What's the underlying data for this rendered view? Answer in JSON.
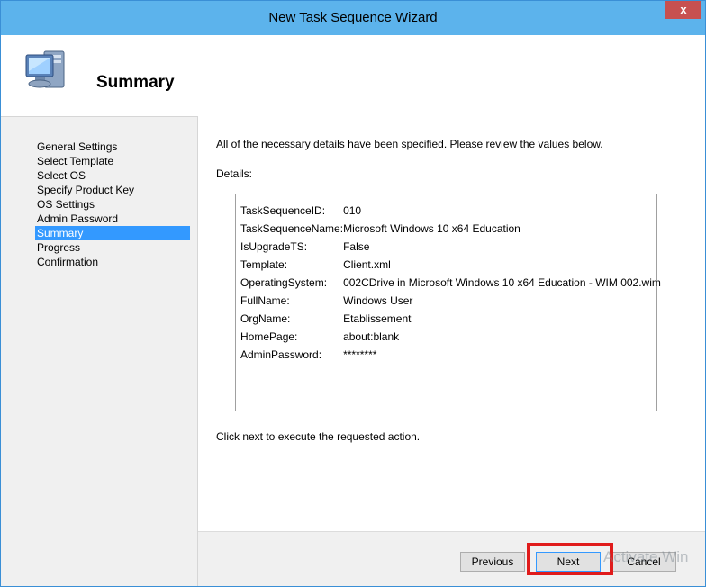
{
  "window": {
    "title": "New Task Sequence Wizard",
    "close_label": "x"
  },
  "header": {
    "title": "Summary",
    "icon": "computer-icon"
  },
  "nav": {
    "items": [
      {
        "label": "General Settings"
      },
      {
        "label": "Select Template"
      },
      {
        "label": "Select OS"
      },
      {
        "label": "Specify Product Key"
      },
      {
        "label": "OS Settings"
      },
      {
        "label": "Admin Password"
      },
      {
        "label": "Summary"
      },
      {
        "label": "Progress"
      },
      {
        "label": "Confirmation"
      }
    ],
    "selected": "Summary"
  },
  "main": {
    "intro": "All of the necessary details have been specified.  Please review the values below.",
    "details_label": "Details:",
    "details": [
      {
        "key": "TaskSequenceID:",
        "value": "010"
      },
      {
        "key": "TaskSequenceName:",
        "value": "Microsoft Windows 10 x64 Education"
      },
      {
        "key": "IsUpgradeTS:",
        "value": "False"
      },
      {
        "key": "Template:",
        "value": "Client.xml"
      },
      {
        "key": "OperatingSystem:",
        "value": "002CDrive in Microsoft Windows 10 x64 Education - WIM 002.wim"
      },
      {
        "key": "FullName:",
        "value": "Windows User"
      },
      {
        "key": "OrgName:",
        "value": "Etablissement"
      },
      {
        "key": "HomePage:",
        "value": "about:blank"
      },
      {
        "key": "AdminPassword:",
        "value": "********"
      }
    ],
    "footer": "Click next to execute the requested action."
  },
  "buttons": {
    "previous": "Previous",
    "next": "Next",
    "cancel": "Cancel"
  },
  "watermark": "Activate Win",
  "colors": {
    "titlebar": "#5cb3ec",
    "selection": "#3399ff",
    "close": "#c75050",
    "highlight": "#e01b1b"
  }
}
